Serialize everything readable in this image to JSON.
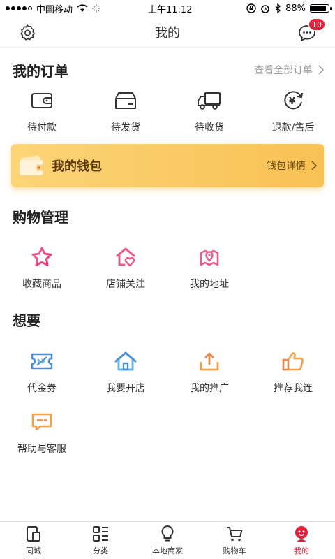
{
  "status_bar": {
    "carrier": "中国移动",
    "time": "上午11:12",
    "battery": "88%",
    "battery_level": 0.88
  },
  "header": {
    "title": "我的",
    "message_badge": "10"
  },
  "orders": {
    "title": "我的订单",
    "see_all": "查看全部订单",
    "items": [
      {
        "label": "待付款",
        "icon": "wallet-icon"
      },
      {
        "label": "待发货",
        "icon": "box-icon"
      },
      {
        "label": "待收货",
        "icon": "truck-icon"
      },
      {
        "label": "退款/售后",
        "icon": "refund-icon"
      }
    ]
  },
  "wallet": {
    "label": "我的钱包",
    "detail": "钱包详情"
  },
  "shopping": {
    "title": "购物管理",
    "items": [
      {
        "label": "收藏商品",
        "icon": "star-icon"
      },
      {
        "label": "店铺关注",
        "icon": "store-heart-icon"
      },
      {
        "label": "我的地址",
        "icon": "map-pin-icon"
      }
    ]
  },
  "wants": {
    "title": "想要",
    "items": [
      {
        "label": "代金券",
        "icon": "coupon-icon"
      },
      {
        "label": "我要开店",
        "icon": "home-icon"
      },
      {
        "label": "我的推广",
        "icon": "share-icon"
      },
      {
        "label": "推荐我连",
        "icon": "thumbs-up-icon"
      },
      {
        "label": "帮助与客服",
        "icon": "chat-help-icon"
      }
    ]
  },
  "tabbar": {
    "items": [
      {
        "label": "同城",
        "icon": "phone-icon"
      },
      {
        "label": "分类",
        "icon": "category-icon"
      },
      {
        "label": "本地商家",
        "icon": "bulb-icon"
      },
      {
        "label": "购物车",
        "icon": "cart-icon"
      },
      {
        "label": "我的",
        "icon": "profile-icon"
      }
    ]
  },
  "colors": {
    "accent": "#e4203a",
    "wallet_gold": "#f8c154"
  }
}
